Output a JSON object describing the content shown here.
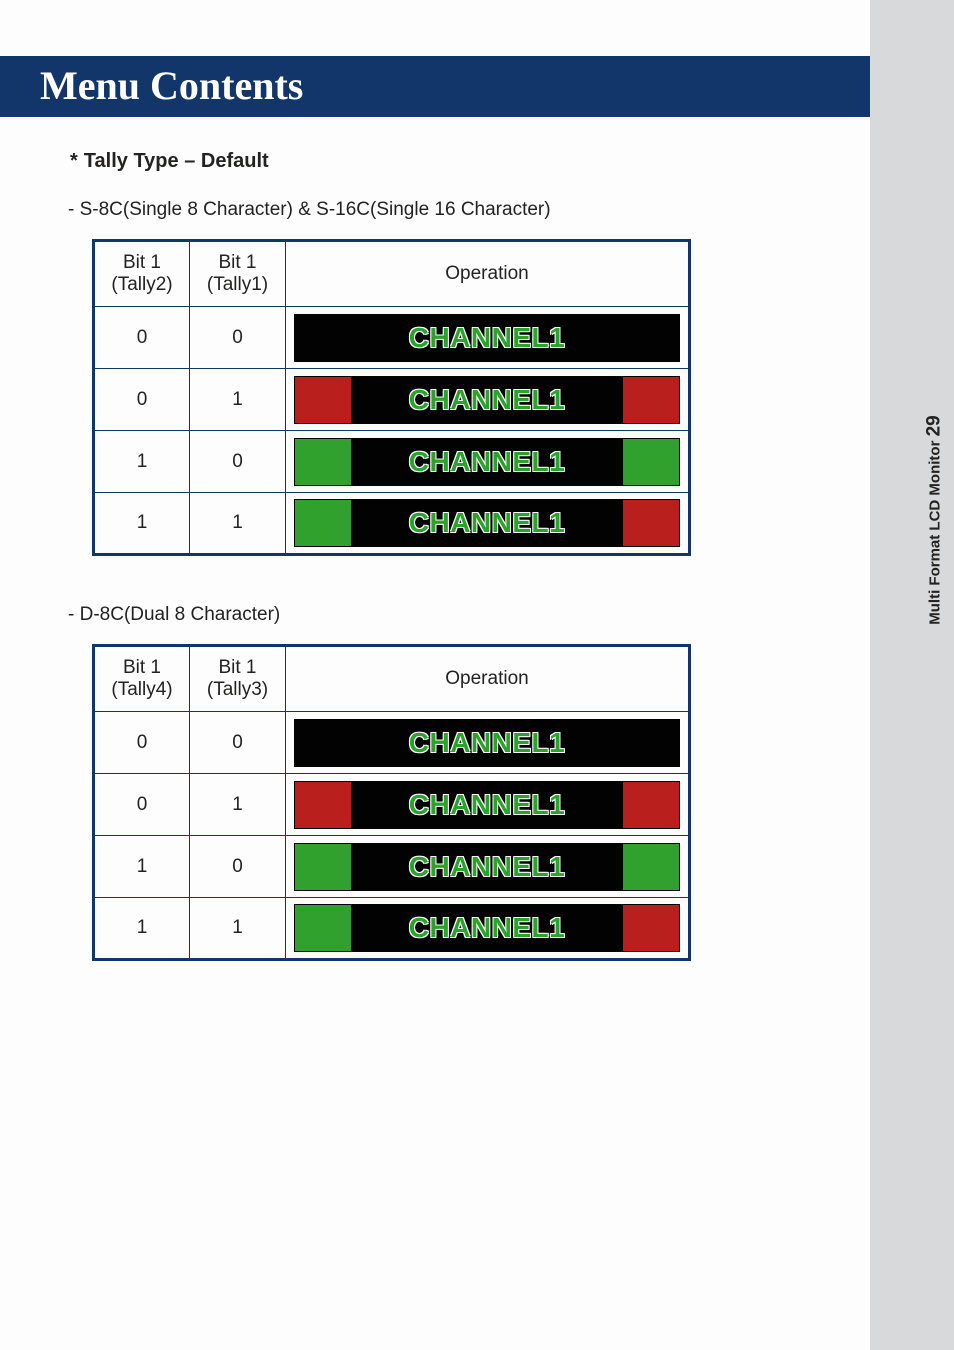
{
  "header": {
    "title": "Menu Contents"
  },
  "section": {
    "title_prefix": "*",
    "title": "Tally Type – Default"
  },
  "tables": [
    {
      "sub_title": "-  S-8C(Single 8 Character)  & S-16C(Single 16 Character)",
      "headers": {
        "col1": "Bit 1\n(Tally2)",
        "col2": "Bit 1\n(Tally1)",
        "col3": "Operation"
      },
      "rows": [
        {
          "b1": "0",
          "b2": "0",
          "left": "black",
          "right": "black",
          "label": "CHANNEL1"
        },
        {
          "b1": "0",
          "b2": "1",
          "left": "red",
          "right": "red",
          "label": "CHANNEL1"
        },
        {
          "b1": "1",
          "b2": "0",
          "left": "green",
          "right": "green",
          "label": "CHANNEL1"
        },
        {
          "b1": "1",
          "b2": "1",
          "left": "green",
          "right": "red",
          "label": "CHANNEL1"
        }
      ]
    },
    {
      "sub_title": "- D-8C(Dual 8 Character)",
      "headers": {
        "col1": "Bit 1\n(Tally4)",
        "col2": "Bit 1\n(Tally3)",
        "col3": "Operation"
      },
      "rows": [
        {
          "b1": "0",
          "b2": "0",
          "left": "black",
          "right": "black",
          "label": "CHANNEL1"
        },
        {
          "b1": "0",
          "b2": "1",
          "left": "red",
          "right": "red",
          "label": "CHANNEL1"
        },
        {
          "b1": "1",
          "b2": "0",
          "left": "green",
          "right": "green",
          "label": "CHANNEL1"
        },
        {
          "b1": "1",
          "b2": "1",
          "left": "green",
          "right": "red",
          "label": "CHANNEL1"
        }
      ]
    }
  ],
  "sidebar": {
    "label": "Multi Format LCD Monitor",
    "page": "29"
  },
  "colors": {
    "black": "#020202",
    "red": "#b91f1c",
    "green": "#2fa12c"
  }
}
